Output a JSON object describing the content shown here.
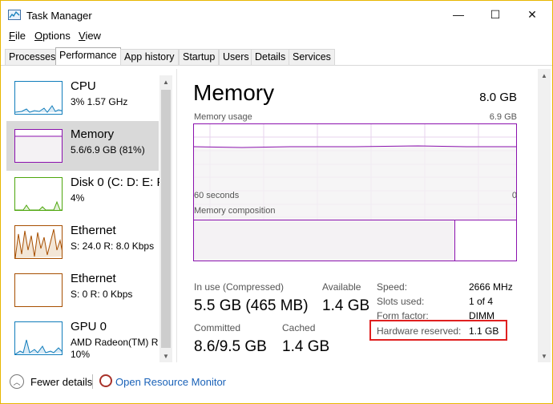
{
  "window": {
    "title": "Task Manager"
  },
  "controls": {
    "minimize": "—",
    "maximize": "☐",
    "close": "✕"
  },
  "menu": [
    {
      "label": "File"
    },
    {
      "label": "Options"
    },
    {
      "label": "View"
    }
  ],
  "tabs": [
    {
      "label": "Processes",
      "active": false
    },
    {
      "label": "Performance",
      "active": true
    },
    {
      "label": "App history",
      "active": false
    },
    {
      "label": "Startup",
      "active": false
    },
    {
      "label": "Users",
      "active": false
    },
    {
      "label": "Details",
      "active": false
    },
    {
      "label": "Services",
      "active": false
    }
  ],
  "sidebar": {
    "items": [
      {
        "name": "CPU",
        "sub": "3% 1.57 GHz",
        "color": "#117dbb"
      },
      {
        "name": "Memory",
        "sub": "5.6/6.9 GB (81%)",
        "color": "#8b12ae"
      },
      {
        "name": "Disk 0 (C: D: E: F",
        "sub": "4%",
        "color": "#4da60c"
      },
      {
        "name": "Ethernet",
        "sub": "S: 24.0  R: 8.0 Kbps",
        "color": "#a74f01"
      },
      {
        "name": "Ethernet",
        "sub": "S: 0  R: 0 Kbps",
        "color": "#a74f01"
      },
      {
        "name": "GPU 0",
        "sub": "AMD Radeon(TM) R",
        "sub2": "10%",
        "color": "#117dbb"
      }
    ]
  },
  "main": {
    "title": "Memory",
    "total": "8.0 GB",
    "usage_label": "Memory usage",
    "usage_max": "6.9 GB",
    "time_label": "60 seconds",
    "time_end": "0",
    "composition_label": "Memory composition",
    "composition_used_fraction": 0.81,
    "stats": {
      "in_use_label": "In use (Compressed)",
      "in_use_value": "5.5 GB (465 MB)",
      "available_label": "Available",
      "available_value": "1.4 GB",
      "committed_label": "Committed",
      "committed_value": "8.6/9.5 GB",
      "cached_label": "Cached",
      "cached_value": "1.4 GB"
    },
    "details": [
      {
        "label": "Speed:",
        "value": "2666 MHz"
      },
      {
        "label": "Slots used:",
        "value": "1 of 4"
      },
      {
        "label": "Form factor:",
        "value": "DIMM"
      },
      {
        "label": "Hardware reserved:",
        "value": "1.1 GB"
      }
    ]
  },
  "footer": {
    "fewer_details": "Fewer details",
    "open_monitor": "Open Resource Monitor"
  },
  "colors": {
    "memory": "#8b12ae",
    "highlight": "#e02020",
    "link": "#1a62b8"
  }
}
